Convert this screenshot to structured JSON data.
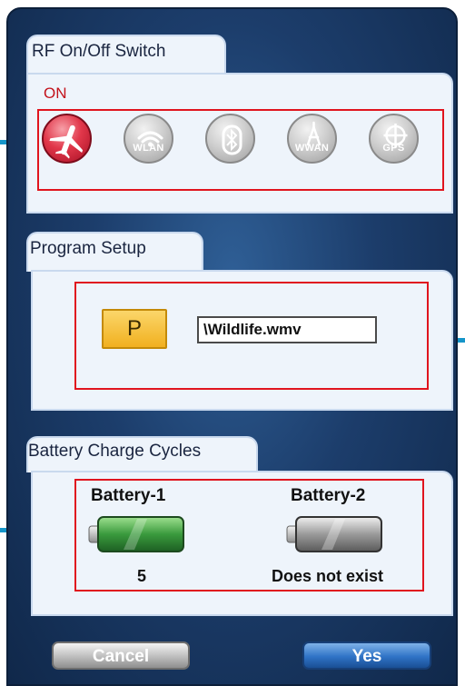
{
  "rf_switch": {
    "title": "RF On/Off Switch",
    "state": "ON",
    "buttons": [
      {
        "name": "airplane",
        "label": "",
        "active": true
      },
      {
        "name": "wlan",
        "label": "WLAN",
        "active": false
      },
      {
        "name": "bluetooth",
        "label": "",
        "active": false
      },
      {
        "name": "wwan",
        "label": "WWAN",
        "active": false
      },
      {
        "name": "gps",
        "label": "GPS",
        "active": false
      }
    ]
  },
  "program_setup": {
    "title": "Program Setup",
    "button_label": "P",
    "file_value": "\\Wildlife.wmv"
  },
  "battery": {
    "title": "Battery Charge Cycles",
    "items": [
      {
        "name": "Battery-1",
        "value": "5",
        "present": true
      },
      {
        "name": "Battery-2",
        "value": "Does not exist",
        "present": false
      }
    ]
  },
  "footer": {
    "cancel_label": "Cancel",
    "yes_label": "Yes"
  },
  "colors": {
    "accent_red": "#e0141e",
    "callout_blue": "#1595c9",
    "battery_green": "#2e8b3a"
  }
}
